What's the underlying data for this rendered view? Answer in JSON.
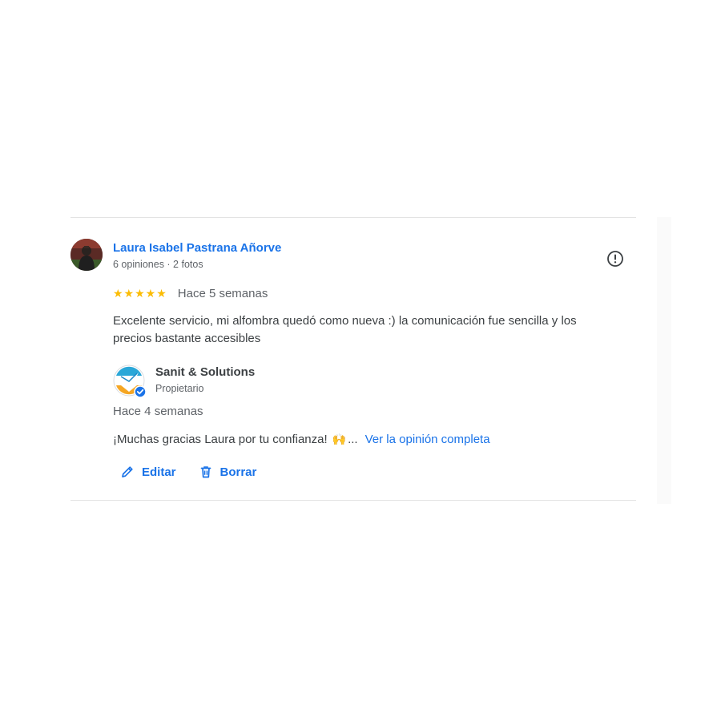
{
  "review": {
    "reviewer_name": "Laura Isabel Pastrana Añorve",
    "reviewer_meta": "6 opiniones · 2 fotos",
    "rating": 5,
    "stars": "★★★★★",
    "date": "Hace 5 semanas",
    "text": "Excelente servicio, mi alfombra quedó como nueva :) la comunicación fue sencilla y los precios bastante accesibles"
  },
  "owner_reply": {
    "owner_name": "Sanit & Solutions",
    "owner_role": "Propietario",
    "date": "Hace 4 semanas",
    "text": "¡Muchas gracias Laura por tu confianza!",
    "emoji": "🙌",
    "ellipsis": "...",
    "see_more_label": "Ver la opinión completa"
  },
  "actions": {
    "edit_label": "Editar",
    "delete_label": "Borrar"
  },
  "icons": {
    "report": "report-exclamation-icon",
    "edit": "pencil-icon",
    "delete": "trash-icon",
    "verified": "verified-check-icon"
  },
  "colors": {
    "link_blue": "#1a73e8",
    "star_yellow": "#fbbc04",
    "secondary_text": "#5f6368",
    "divider": "#e3e3e3"
  }
}
